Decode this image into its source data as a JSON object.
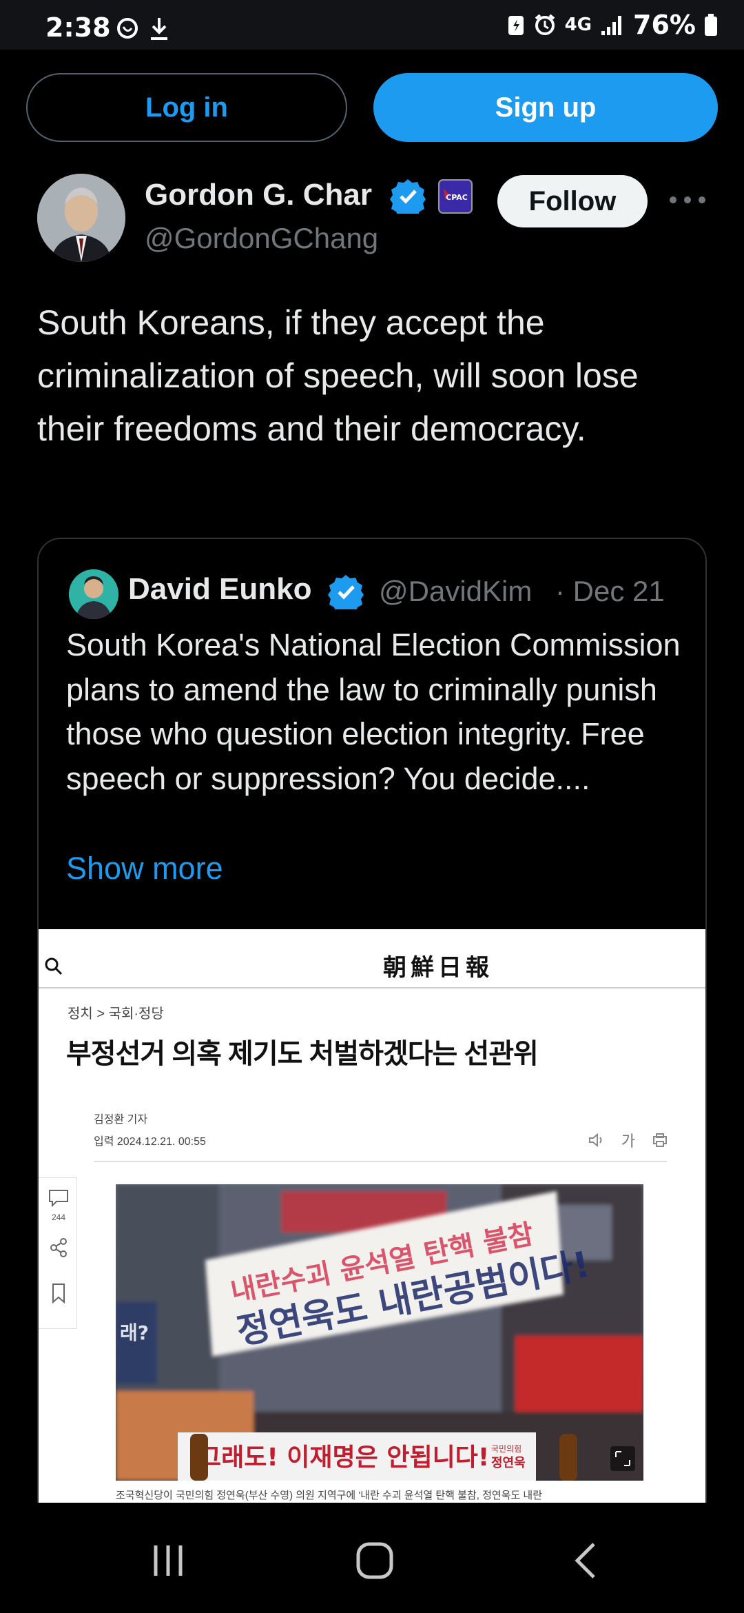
{
  "status_bar": {
    "time": "2:38",
    "network": "4G",
    "battery": "76%",
    "icons": [
      "whatsapp-icon",
      "download-icon",
      "battery-saver-icon",
      "alarm-icon",
      "signal-icon",
      "battery-icon"
    ]
  },
  "header": {
    "login_label": "Log in",
    "signup_label": "Sign up"
  },
  "tweet": {
    "author_name": "Gordon G. Char",
    "author_handle": "@GordonGChang",
    "affiliation_badge": "CPAC",
    "follow_label": "Follow",
    "text": "South Koreans, if they accept the criminalization of speech, will soon lose their freedoms and their democracy."
  },
  "quoted_tweet": {
    "author_name": "David Eunko",
    "author_handle": "@DavidKim",
    "date": "· Dec 21",
    "text": "South Korea's National Election Commission plans to amend the law to criminally punish those who question election integrity. Free speech or suppression? You decide....",
    "show_more_label": "Show more"
  },
  "article_image": {
    "logo": "朝鮮日報",
    "breadcrumb": "정치 > 국회·정당",
    "headline": "부정선거 의혹 제기도 처벌하겠다는 선관위",
    "reporter": "김정환 기자",
    "published": "입력 2024.12.21. 00:55",
    "font_size_label": "가",
    "comment_count": "244",
    "banner_line1": "내란수괴 윤석열 탄핵 불참",
    "banner_line2": "정연욱도 내란공범이다!",
    "bottom_banner": "그래도! 이재명은 안됩니다!",
    "bottom_banner_party": "국민의힘",
    "bottom_banner_name": "정연욱",
    "side_sign": "래?",
    "caption": "조국혁신당이 국민의힘 정연욱(부산 수영) 의원 지역구에 '내란 수괴 윤석열 탄핵 불참, 정연욱도 내란"
  },
  "colors": {
    "background": "#000000",
    "accent_blue": "#1d9bf0",
    "text_primary": "#e7e9ea",
    "text_secondary": "#71767b",
    "border": "#2f3336"
  }
}
